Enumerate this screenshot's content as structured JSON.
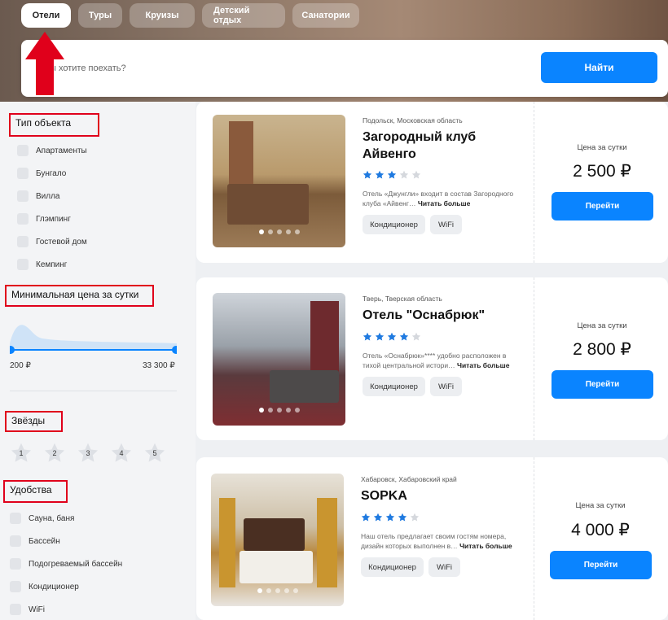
{
  "tabs": [
    {
      "label": "Отели",
      "active": true
    },
    {
      "label": "Туры",
      "active": false
    },
    {
      "label": "Круизы",
      "active": false
    },
    {
      "label": "Детский отдых",
      "active": false
    },
    {
      "label": "Санатории",
      "active": false
    }
  ],
  "search": {
    "placeholder": "Куда вы хотите поехать?",
    "visible_placeholder": "а вы хотите поехать?",
    "button_label": "Найти"
  },
  "filters": {
    "object_type": {
      "title": "Тип объекта",
      "items": [
        "Апартаменты",
        "Бунгало",
        "Вилла",
        "Глэмпинг",
        "Гостевой дом",
        "Кемпинг"
      ]
    },
    "min_price": {
      "title": "Минимальная цена за сутки",
      "min_label": "200 ₽",
      "max_label": "33 300 ₽"
    },
    "stars": {
      "title": "Звёзды",
      "options": [
        "1",
        "2",
        "3",
        "4",
        "5"
      ]
    },
    "amenities": {
      "title": "Удобства",
      "items": [
        "Сауна, баня",
        "Бассейн",
        "Подогреваемый бассейн",
        "Кондиционер",
        "WiFi"
      ]
    }
  },
  "hotels": [
    {
      "location": "Подольск, Московская область",
      "name": "Загородный клуб Айвенго",
      "stars": 3,
      "description": "Отель «Джунгли» входит в состав Загородного клуба «Айвенг…",
      "read_more": "Читать больше",
      "chips": [
        "Кондиционер",
        "WiFi"
      ],
      "price_caption": "Цена за сутки",
      "price": "2 500 ₽",
      "button_label": "Перейти"
    },
    {
      "location": "Тверь, Тверская область",
      "name": "Отель \"Оснабрюк\"",
      "stars": 4,
      "description": "Отель «Оснабрюк»**** удобно расположен в тихой центральной истори…",
      "read_more": "Читать больше",
      "chips": [
        "Кондиционер",
        "WiFi"
      ],
      "price_caption": "Цена за сутки",
      "price": "2 800 ₽",
      "button_label": "Перейти"
    },
    {
      "location": "Хабаровск, Хабаровский край",
      "name": "SOPKA",
      "stars": 4,
      "description": "Наш отель предлагает своим гостям номера, дизайн которых выполнен в…",
      "read_more": "Читать больше",
      "chips": [
        "Кондиционер",
        "WiFi"
      ],
      "price_caption": "Цена за сутки",
      "price": "4 000 ₽",
      "button_label": "Перейти"
    }
  ],
  "colors": {
    "accent": "#0a84ff",
    "annotation": "#e0001b",
    "star_on": "#1f7ae0",
    "star_off": "#d5d8dd"
  },
  "icons": [
    "star-icon",
    "annotation-arrow-icon"
  ]
}
